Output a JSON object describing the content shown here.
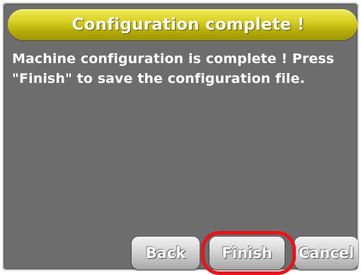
{
  "dialog": {
    "title": "Configuration complete !",
    "message": "Machine configuration is complete ! Press\n\"Finish\" to save the configuration file."
  },
  "buttons": {
    "back_label": "Back",
    "finish_label": "Finish",
    "cancel_label": "Cancel"
  },
  "colors": {
    "panel_background": "#6d6d6d",
    "title_bar": "#cfc61a",
    "highlight_ring": "#e8141b",
    "button": "#d0d0d0"
  }
}
